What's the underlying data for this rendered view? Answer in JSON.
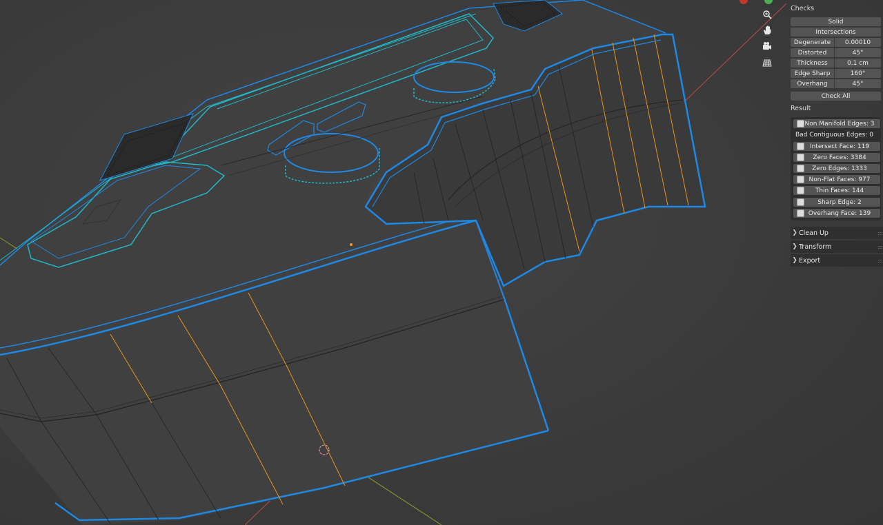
{
  "viewport": {
    "nav_icons": [
      "zoom-icon",
      "hand-pan-icon",
      "camera-icon",
      "grid-icon"
    ],
    "colors": {
      "background": "#3d3d3d",
      "selected_edge": "#1e88e5",
      "seam_edge": "#1fb8c8",
      "sharp_edge": "#e8941a",
      "x_axis": "#c04848",
      "y_axis": "#8f9a2a",
      "gizmo_red": "#c0392b",
      "gizmo_green": "#4caf50"
    }
  },
  "panel": {
    "checks_title": "Checks",
    "solid_label": "Solid",
    "intersections_label": "Intersections",
    "properties": [
      {
        "label": "Degenerate",
        "value": "0.00010"
      },
      {
        "label": "Distorted",
        "value": "45°"
      },
      {
        "label": "Thickness",
        "value": "0.1 cm"
      },
      {
        "label": "Edge Sharp",
        "value": "160°"
      },
      {
        "label": "Overhang",
        "value": "45°"
      }
    ],
    "check_all_label": "Check All",
    "result_title": "Result",
    "results": {
      "non_manifold": "Non Manifold Edges: 3",
      "bad_contiguous": "Bad Contiguous Edges: 0",
      "intersect": "Intersect Face: 119",
      "zero_faces": "Zero Faces: 3384",
      "zero_edges": "Zero Edges: 1333",
      "non_flat": "Non-Flat Faces: 977",
      "thin_faces": "Thin Faces: 144",
      "sharp_edge": "Sharp Edge: 2",
      "overhang_face": "Overhang Face: 139"
    },
    "subpanels": [
      "Clean Up",
      "Transform",
      "Export"
    ]
  }
}
